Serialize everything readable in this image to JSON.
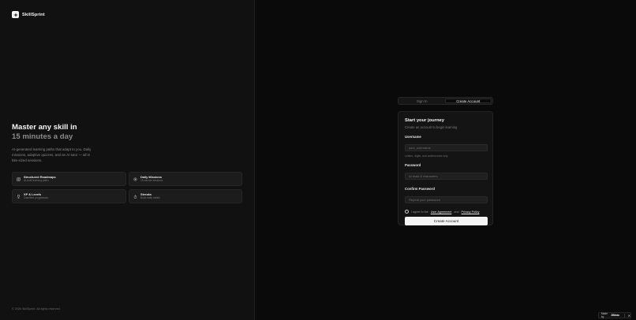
{
  "brand": {
    "name": "SkillSprint",
    "logo_icon": "sparkle-icon"
  },
  "hero": {
    "title_line1": "Master any skill in",
    "title_line2": "15 minutes a day",
    "description": "AI-generated learning paths that adapt to you. Daily missions, adaptive quizzes, and an AI tutor — all in bite-sized sessions."
  },
  "features": [
    {
      "icon": "map-icon",
      "title": "Structured Roadmaps",
      "subtitle": "AI-built learning paths"
    },
    {
      "icon": "target-icon",
      "title": "Daily Missions",
      "subtitle": "15-minute sessions"
    },
    {
      "icon": "trophy-icon",
      "title": "XP & Levels",
      "subtitle": "Gamified progression"
    },
    {
      "icon": "flame-icon",
      "title": "Streaks",
      "subtitle": "Build daily habits"
    }
  ],
  "footer": {
    "copyright": "© 2026 SkillSprint. All rights reserved."
  },
  "tabs": [
    {
      "label": "Sign In",
      "active": false
    },
    {
      "label": "Create Account",
      "active": true
    }
  ],
  "form": {
    "title": "Start your journey",
    "subtitle": "Create an account to begin learning",
    "username_label": "Username",
    "username_placeholder": "your_username",
    "username_hint": "Letters, digits, and underscores only",
    "password_label": "Password",
    "password_placeholder": "At least 8 characters",
    "confirm_label": "Confirm Password",
    "confirm_placeholder": "Repeat your password",
    "agree_prefix": "I agree to the",
    "agree_link1": "User Agreement",
    "agree_and": "and",
    "agree_link2": "Privacy Policy",
    "submit_label": "Create Account"
  },
  "badge": {
    "made_by": "Made by",
    "brand": "ZiMoto",
    "close": "✕"
  },
  "colors": {
    "background": "#0a0a0a",
    "panel": "#111111",
    "accent": "#f5f5f5",
    "muted": "#8a8a8a"
  }
}
